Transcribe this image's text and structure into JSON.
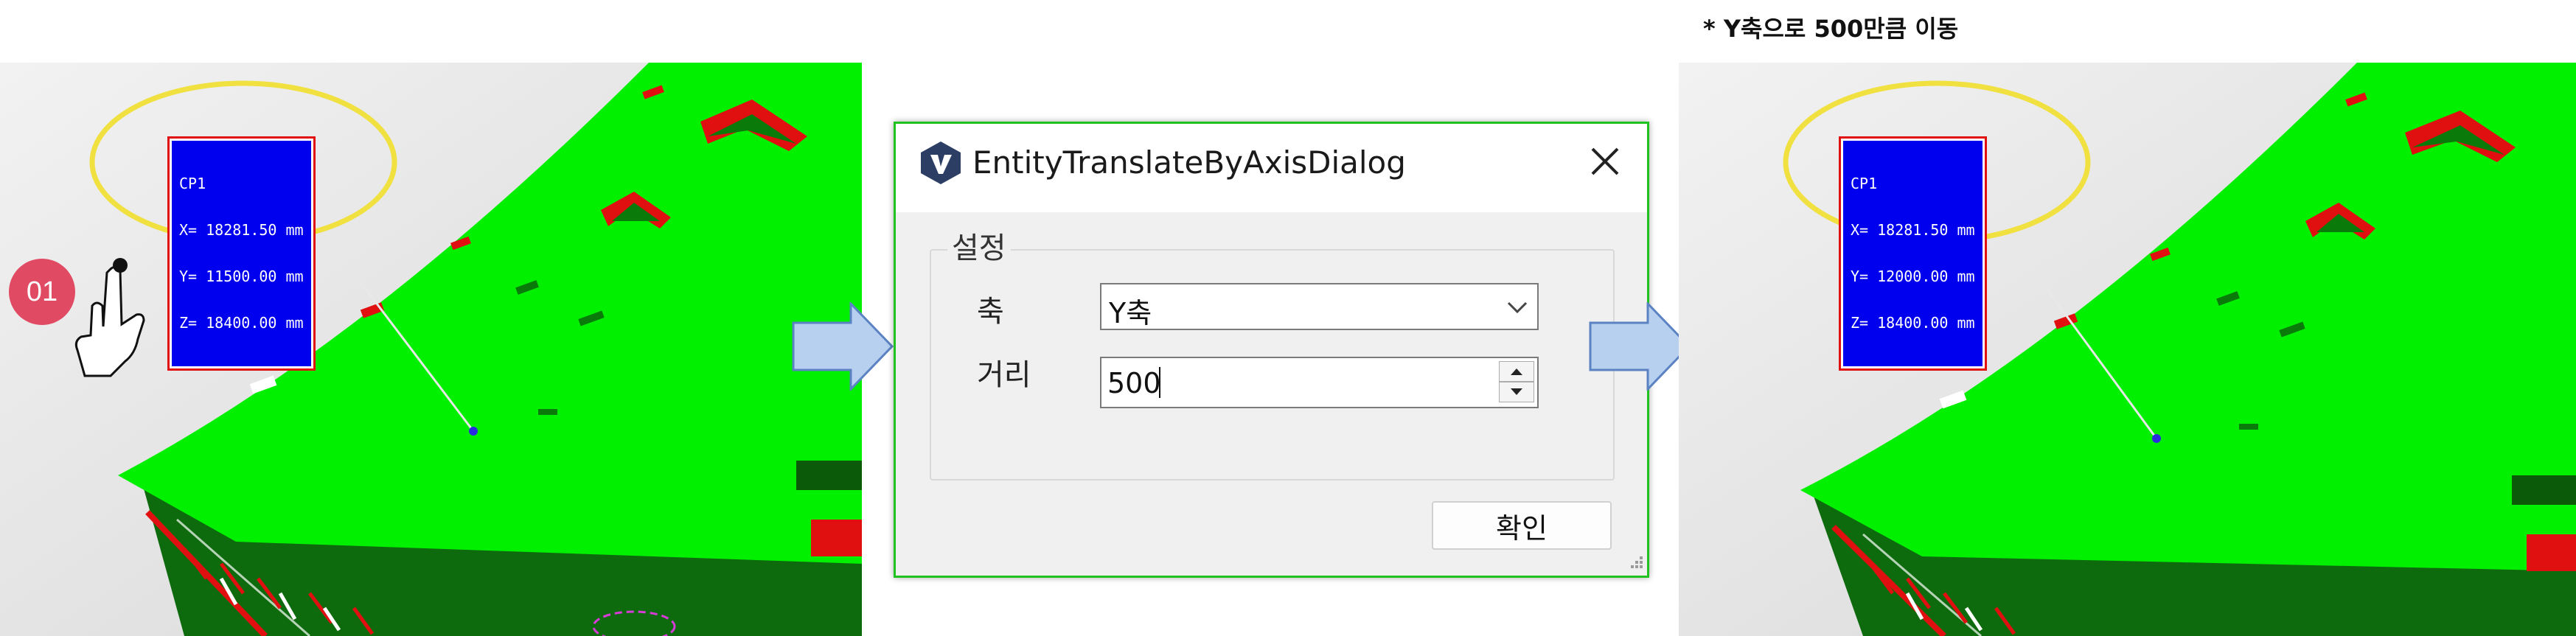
{
  "caption": "* Y축으로 500만큼 이동",
  "before": {
    "step_badge": "01",
    "coord_label": {
      "name": "CP1",
      "x": "X= 18281.50 mm",
      "y": "Y= 11500.00 mm",
      "z": "Z= 18400.00 mm"
    }
  },
  "after": {
    "coord_label": {
      "name": "CP1",
      "x": "X= 18281.50 mm",
      "y": "Y= 12000.00 mm",
      "z": "Z= 18400.00 mm"
    }
  },
  "dialog": {
    "title": "EntityTranslateByAxisDialog",
    "group_title": "설정",
    "axis_label": "축",
    "axis_value": "Y축",
    "distance_label": "거리",
    "distance_value": "500",
    "ok_label": "확인"
  },
  "colors": {
    "model_surface": "#00f000",
    "model_edge": "#e01010",
    "label_background": "#0000ee",
    "highlight_ellipse": "#f0e040",
    "badge": "#e04a63",
    "arrow_fill": "#b8d0f0",
    "arrow_border": "#5b82c2"
  },
  "icons": [
    "app-logo-icon",
    "close-icon",
    "chevron-down-icon",
    "spin-up-icon",
    "spin-down-icon",
    "resize-grip-icon",
    "hand-pointer-icon",
    "arrow-right-icon"
  ]
}
